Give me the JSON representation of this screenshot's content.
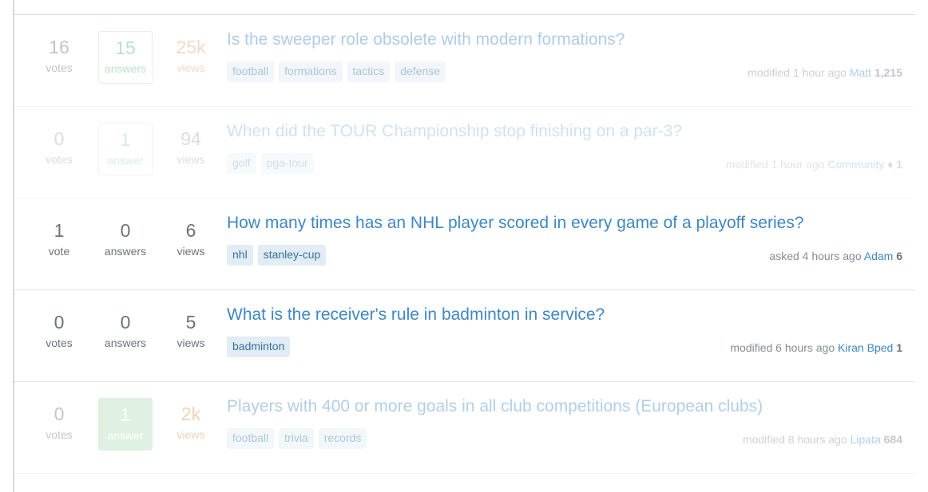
{
  "list": {
    "rows": [
      {
        "opacity_class": "fade-1",
        "votes": {
          "count": "16",
          "label": "votes",
          "state": "plain"
        },
        "answers": {
          "count": "15",
          "label": "answers",
          "state": "answered"
        },
        "views": {
          "count": "25k",
          "label": "views",
          "state": "hot-strong"
        },
        "title": "Is the sweeper role obsolete with modern formations?",
        "tags": [
          "football",
          "formations",
          "tactics",
          "defense"
        ],
        "meta": {
          "action": "modified 1 hour ago",
          "user": "Matt",
          "rep": "1,215",
          "flair": ""
        }
      },
      {
        "opacity_class": "fade-2",
        "votes": {
          "count": "0",
          "label": "votes",
          "state": "plain"
        },
        "answers": {
          "count": "1",
          "label": "answer",
          "state": "answered"
        },
        "views": {
          "count": "94",
          "label": "views",
          "state": "plain"
        },
        "title": "When did the TOUR Championship stop finishing on a par-3?",
        "tags": [
          "golf",
          "pga-tour"
        ],
        "meta": {
          "action": "modified 1 hour ago",
          "user": "Community",
          "rep": "1",
          "flair": "♦"
        }
      },
      {
        "opacity_class": "",
        "votes": {
          "count": "1",
          "label": "vote",
          "state": "plain"
        },
        "answers": {
          "count": "0",
          "label": "answers",
          "state": "plain"
        },
        "views": {
          "count": "6",
          "label": "views",
          "state": "plain"
        },
        "title": "How many times has an NHL player scored in every game of a playoff series?",
        "tags": [
          "nhl",
          "stanley-cup"
        ],
        "meta": {
          "action": "asked 4 hours ago",
          "user": "Adam",
          "rep": "6",
          "flair": ""
        }
      },
      {
        "opacity_class": "",
        "votes": {
          "count": "0",
          "label": "votes",
          "state": "plain"
        },
        "answers": {
          "count": "0",
          "label": "answers",
          "state": "plain"
        },
        "views": {
          "count": "5",
          "label": "views",
          "state": "plain"
        },
        "title": "What is the receiver's rule in badminton in service?",
        "tags": [
          "badminton"
        ],
        "meta": {
          "action": "modified 6 hours ago",
          "user": "Kiran Bped",
          "rep": "1",
          "flair": ""
        }
      },
      {
        "opacity_class": "fade-3",
        "votes": {
          "count": "0",
          "label": "votes",
          "state": "plain"
        },
        "answers": {
          "count": "1",
          "label": "answer",
          "state": "accepted"
        },
        "views": {
          "count": "2k",
          "label": "views",
          "state": "hot"
        },
        "title": "Players with 400 or more goals in all club competitions (European clubs)",
        "tags": [
          "football",
          "trivia",
          "records"
        ],
        "meta": {
          "action": "modified 8 hours ago",
          "user": "Lipata",
          "rep": "684",
          "flair": ""
        }
      }
    ]
  },
  "colors": {
    "link": "#3f87c2",
    "tag_bg": "#e1ecf4",
    "tag_fg": "#39739d",
    "answered_border": "#c0dcc0",
    "answered_fg": "#5eba7d",
    "accepted_bg": "#b3dbb8",
    "hot_views": "#d1954a",
    "muted": "#6a737c",
    "rule": "#e4e6e8"
  }
}
